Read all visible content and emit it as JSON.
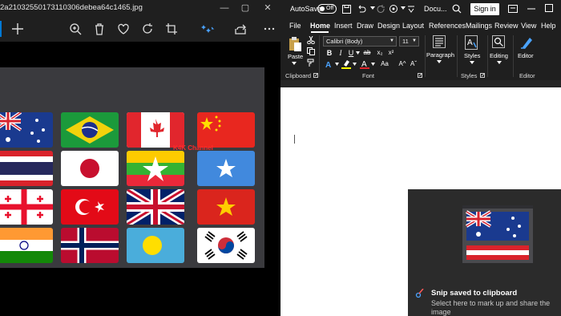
{
  "photos": {
    "file_title": "2a21032550173110306debea64c1465.jpg",
    "watermark": "K4K Channel",
    "toolbar": {
      "add": "plus-icon",
      "zoom": "zoom-in-icon",
      "delete": "trash-icon",
      "favorite": "heart-icon",
      "rotate": "rotate-icon",
      "crop": "crop-icon",
      "edit": "edit-icon",
      "share": "share-icon",
      "more": "more-icon"
    },
    "window_controls": {
      "minimize": "—",
      "maximize": "▢",
      "close": "✕"
    }
  },
  "word": {
    "autosave_label": "AutoSave",
    "autosave_state": "Off",
    "doc_name": "Docu...",
    "signin_label": "Sign in",
    "tabs": [
      "File",
      "Home",
      "Insert",
      "Draw",
      "Design",
      "Layout",
      "References",
      "Mailings",
      "Review",
      "View",
      "Help"
    ],
    "active_tab": "Home",
    "ribbon": {
      "paste_label": "Paste",
      "font_name": "Calibri (Body)",
      "font_size": "11",
      "paragraph_label": "Paragraph",
      "styles_label": "Styles",
      "editing_label": "Editing",
      "editor_label": "Editor",
      "groups": {
        "clipboard": "Clipboard",
        "font": "Font",
        "styles": "Styles",
        "editor": "Editor"
      },
      "format_buttons": {
        "bold": "B",
        "italic": "I",
        "underline": "U",
        "strike": "ab",
        "sub": "x₂",
        "sup": "x²",
        "case": "Aa",
        "grow": "A^",
        "shrink": "Aˇ"
      }
    }
  },
  "toast": {
    "title": "Snip saved to clipboard",
    "body": "Select here to mark up and share the image"
  },
  "colors": {
    "accent": "#0078d4",
    "dark_bg": "#1f1f1f",
    "toast_bg": "#2b2b2b"
  }
}
